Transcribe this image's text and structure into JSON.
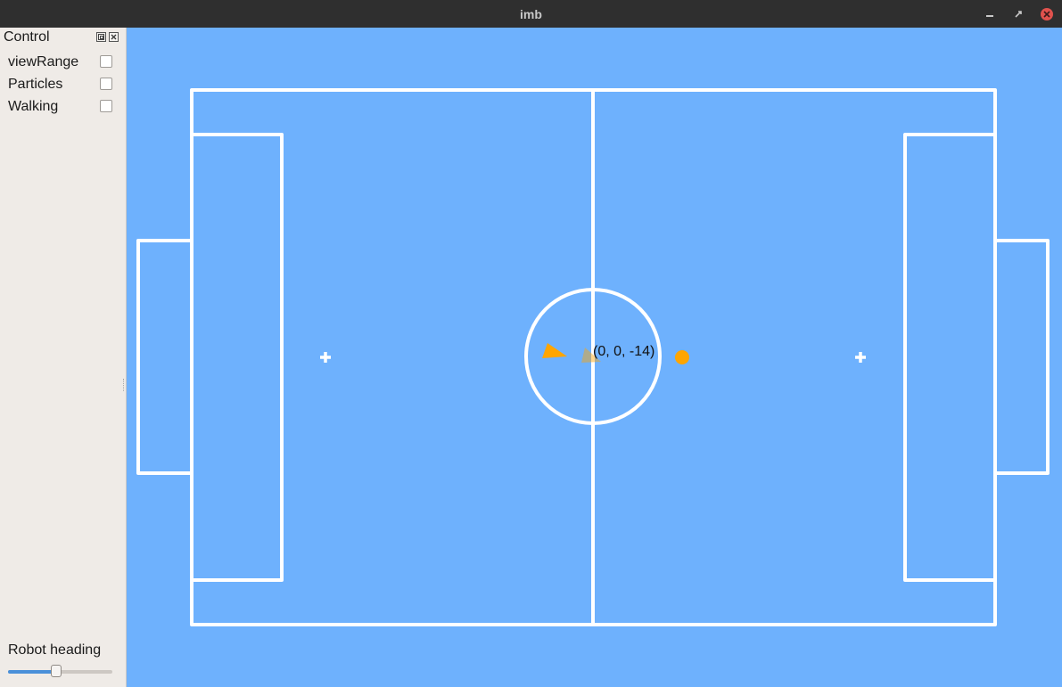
{
  "window": {
    "title": "imb"
  },
  "control_panel": {
    "title": "Control",
    "options": [
      {
        "label": "viewRange",
        "checked": false
      },
      {
        "label": "Particles",
        "checked": false
      },
      {
        "label": "Walking",
        "checked": false
      }
    ],
    "heading": {
      "label": "Robot heading",
      "fraction": 0.46
    }
  },
  "field": {
    "background_color": "#6eb1fd",
    "line_color": "#ffffff",
    "robot_pose_label": "(0, 0, -14)",
    "robot_color": "#ffa500",
    "ball_color": "#ffa500"
  }
}
